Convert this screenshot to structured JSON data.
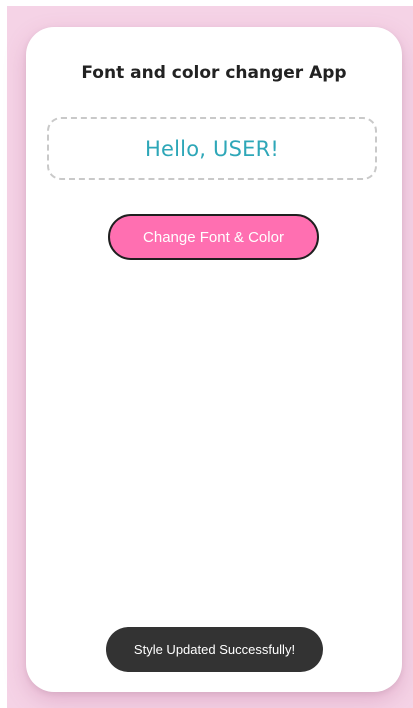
{
  "app": {
    "title": "Font and color changer App"
  },
  "greeting": {
    "text": "Hello, USER!",
    "color": "#2ea7b8"
  },
  "change_button": {
    "label": "Change Font & Color",
    "color": "#ff6fb1"
  },
  "toast": {
    "message": "Style Updated Successfully!"
  },
  "colors": {
    "backdrop": "#f5d3e6",
    "card": "#ffffff",
    "toast_bg": "#333333"
  }
}
